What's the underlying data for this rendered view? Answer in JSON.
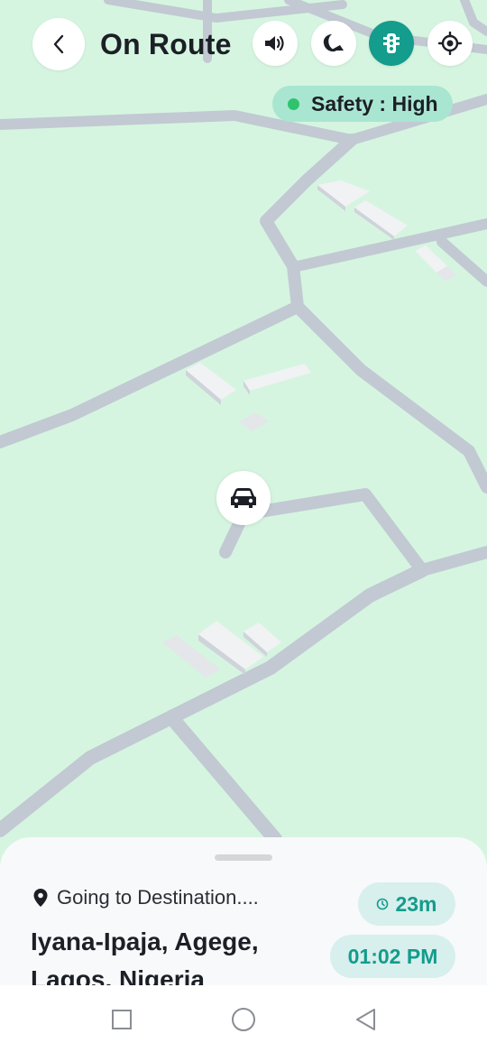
{
  "header": {
    "title": "On Route",
    "back_icon": "chevron-left-icon",
    "controls": [
      {
        "name": "sound",
        "icon": "speaker-icon"
      },
      {
        "name": "night-mode",
        "icon": "moon-icon"
      },
      {
        "name": "traffic",
        "icon": "traffic-light-icon",
        "active": true,
        "color": "#149c8c"
      },
      {
        "name": "locate",
        "icon": "crosshair-icon"
      }
    ]
  },
  "safety": {
    "label": "Safety : High",
    "dot_color": "#2fc36e"
  },
  "map": {
    "background": "#d5f5e0",
    "road_color": "#c2c9d3",
    "building_color": "#e4e6ea",
    "vehicle_icon": "car-icon"
  },
  "trip": {
    "status": "Going to Destination....",
    "destination_line1": "Iyana-Ipaja, Agege,",
    "destination_line2": "Lagos, Nigeria",
    "eta": "23m",
    "arrival_time": "01:02 PM",
    "accent": "#149c8c"
  },
  "system_nav": {
    "icons": [
      "square-icon",
      "circle-icon",
      "triangle-back-icon"
    ]
  }
}
